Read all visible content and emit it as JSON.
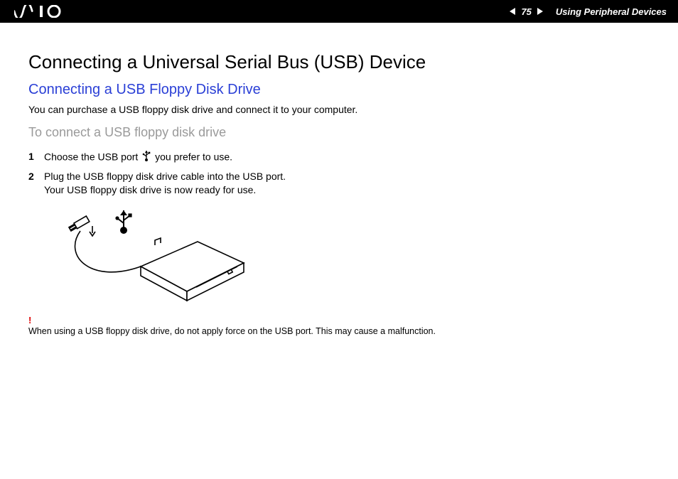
{
  "header": {
    "logo_text": "VAIO",
    "page_number": "75",
    "section": "Using Peripheral Devices"
  },
  "page": {
    "title": "Connecting a Universal Serial Bus (USB) Device",
    "subtitle": "Connecting a USB Floppy Disk Drive",
    "intro": "You can purchase a USB floppy disk drive and connect it to your computer.",
    "task": "To connect a USB floppy disk drive",
    "steps": [
      {
        "n": "1",
        "pre": "Choose the USB port ",
        "post": " you prefer to use."
      },
      {
        "n": "2",
        "pre": "Plug the USB floppy disk drive cable into the USB port.",
        "post2": "Your USB floppy disk drive is now ready for use."
      }
    ],
    "warning_mark": "!",
    "warning_text": "When using a USB floppy disk drive, do not apply force on the USB port. This may cause a malfunction."
  }
}
